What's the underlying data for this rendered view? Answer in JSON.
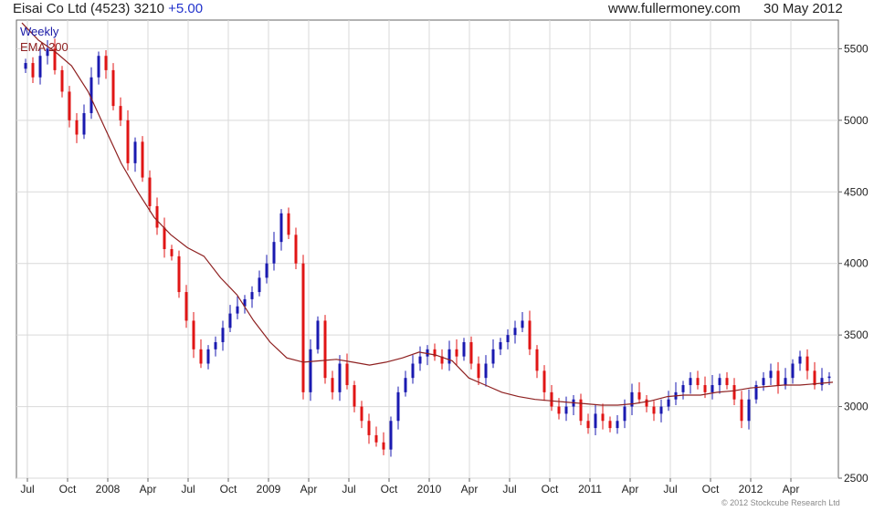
{
  "header": {
    "name": "Eisai Co Ltd (4523)",
    "price": "3210",
    "change": "+5.00",
    "site": "www.fullermoney.com",
    "date": "30 May 2012"
  },
  "legend": {
    "period": "Weekly",
    "ema": "EMA 200"
  },
  "copyright": "© 2012 Stockcube Research Ltd",
  "colors": {
    "up": "#1a1ab0",
    "down": "#e01515",
    "ema": "#8e2020",
    "grid": "#d9d9d9"
  },
  "chart_data": {
    "type": "candlestick",
    "ylim": [
      2500,
      5700
    ],
    "yticks": [
      2500,
      3000,
      3500,
      4000,
      4500,
      5000,
      5500
    ],
    "xtick_labels": [
      "Jul",
      "Oct",
      "2008",
      "Apr",
      "Jul",
      "Oct",
      "2009",
      "Apr",
      "Jul",
      "Oct",
      "2010",
      "Apr",
      "Jul",
      "Oct",
      "2011",
      "Apr",
      "Jul",
      "Oct",
      "2012",
      "Apr"
    ],
    "weekly_close": [
      5400,
      5300,
      5450,
      5500,
      5350,
      5200,
      5000,
      4900,
      5050,
      5300,
      5450,
      5350,
      5100,
      5000,
      4700,
      4850,
      4600,
      4400,
      4250,
      4100,
      4050,
      3800,
      3600,
      3400,
      3300,
      3400,
      3450,
      3550,
      3650,
      3700,
      3750,
      3800,
      3900,
      4000,
      4150,
      4350,
      4200,
      4000,
      3100,
      3400,
      3600,
      3200,
      3100,
      3300,
      3150,
      3000,
      2900,
      2800,
      2750,
      2700,
      2900,
      3100,
      3200,
      3300,
      3350,
      3400,
      3350,
      3300,
      3400,
      3350,
      3450,
      3300,
      3200,
      3300,
      3400,
      3450,
      3500,
      3550,
      3600,
      3400,
      3250,
      3100,
      3000,
      2950,
      3000,
      3050,
      2900,
      2850,
      2950,
      2900,
      2850,
      2900,
      3000,
      3100,
      3050,
      3000,
      2950,
      3000,
      3050,
      3100,
      3150,
      3200,
      3150,
      3100,
      3150,
      3200,
      3150,
      3050,
      2900,
      3050,
      3150,
      3200,
      3250,
      3150,
      3200,
      3300,
      3350,
      3250,
      3150,
      3200,
      3210
    ],
    "ema200": [
      5680,
      5560,
      5480,
      5380,
      5200,
      4950,
      4700,
      4500,
      4320,
      4200,
      4110,
      4050,
      3900,
      3780,
      3600,
      3450,
      3340,
      3310,
      3320,
      3330,
      3310,
      3290,
      3310,
      3340,
      3380,
      3360,
      3320,
      3200,
      3150,
      3100,
      3070,
      3050,
      3040,
      3030,
      3020,
      3010,
      3010,
      3020,
      3040,
      3070,
      3080,
      3080,
      3100,
      3110,
      3130,
      3140,
      3150,
      3150,
      3160,
      3170
    ],
    "ema_x_start": 0
  }
}
